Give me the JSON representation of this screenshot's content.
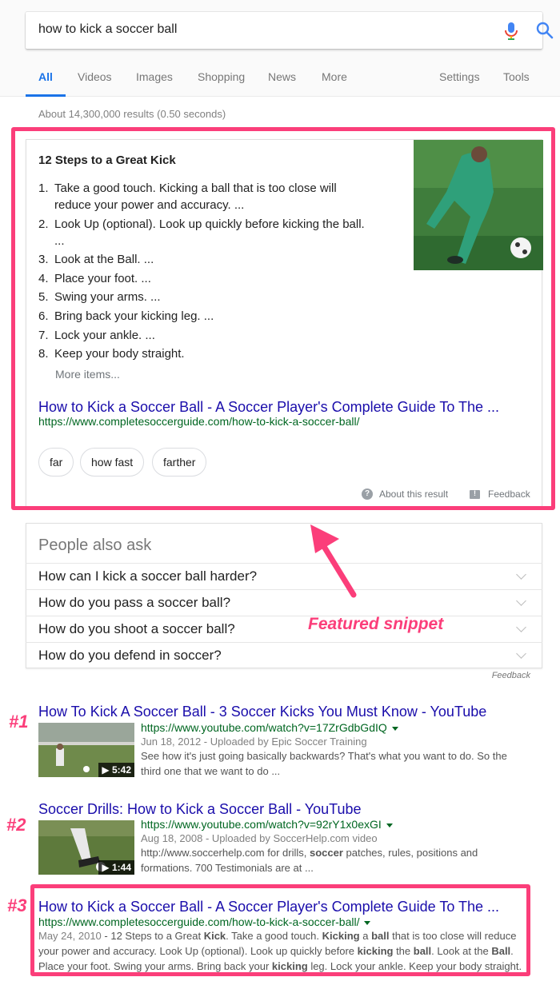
{
  "search": {
    "query": "how to kick a soccer ball"
  },
  "tabs": [
    "All",
    "Videos",
    "Images",
    "Shopping",
    "News",
    "More",
    "Settings",
    "Tools"
  ],
  "stats": "About 14,300,000 results (0.50 seconds)",
  "snippet": {
    "title": "12 Steps to a Great Kick",
    "steps": [
      {
        "num": "1.",
        "lines": [
          "Take a good touch. Kicking a ball that is too close will",
          "reduce your power and accuracy. ..."
        ]
      },
      {
        "num": "2.",
        "lines": [
          "Look Up (optional). Look up quickly before kicking the ball.",
          "..."
        ]
      },
      {
        "num": "3.",
        "lines": [
          "Look at the Ball. ..."
        ]
      },
      {
        "num": "4.",
        "lines": [
          "Place your foot. ..."
        ]
      },
      {
        "num": "5.",
        "lines": [
          "Swing your arms. ..."
        ]
      },
      {
        "num": "6.",
        "lines": [
          "Bring back your kicking leg. ..."
        ]
      },
      {
        "num": "7.",
        "lines": [
          "Lock your ankle. ..."
        ]
      },
      {
        "num": "8.",
        "lines": [
          "Keep your body straight."
        ]
      }
    ],
    "more_items": "More items...",
    "result_title": "How to Kick a Soccer Ball - A Soccer Player's Complete Guide To The ...",
    "result_url": "https://www.completesoccerguide.com/how-to-kick-a-soccer-ball/",
    "chips": [
      "far",
      "how fast",
      "farther"
    ],
    "about": "About this result",
    "feedback": "Feedback"
  },
  "annotations": {
    "featured": "Featured snippet",
    "r1": "#1",
    "r2": "#2",
    "r3": "#3"
  },
  "paa": {
    "title": "People also ask",
    "questions": [
      "How can I kick a soccer ball harder?",
      "How do you pass a soccer ball?",
      "How do you shoot a soccer ball?",
      "How do you defend in soccer?"
    ],
    "feedback": "Feedback"
  },
  "results": [
    {
      "title": "How To Kick A Soccer Ball - 3 Soccer Kicks You Must Know - YouTube",
      "url": "https://www.youtube.com/watch?v=17ZrGdbGdIQ",
      "meta": "Jun 18, 2012 - Uploaded by Epic Soccer Training",
      "desc1": "See how it's just going basically backwards? That's what you want to do. So the",
      "desc2": "third one that we want to do ...",
      "duration": "▶ 5:42"
    },
    {
      "title": "Soccer Drills: How to Kick a Soccer Ball - YouTube",
      "url": "https://www.youtube.com/watch?v=92rY1x0exGI",
      "meta": "Aug 18, 2008 - Uploaded by SoccerHelp.com video",
      "desc1a": "http://www.soccerhelp.com for drills, ",
      "desc1b": "soccer",
      "desc1c": " patches, rules, positions and",
      "desc2": "formations. 700 Testimonials are at ...",
      "duration": "▶ 1:44"
    },
    {
      "title": "How to Kick a Soccer Ball - A Soccer Player's Complete Guide To The ...",
      "url": "https://www.completesoccerguide.com/how-to-kick-a-soccer-ball/",
      "date": "May 24, 2010",
      "line1": [
        " - 12 Steps to a Great ",
        "Kick",
        ". Take a good touch. ",
        "Kicking",
        " a ",
        "ball",
        " that is too close will reduce"
      ],
      "line2": [
        "your power and accuracy. Look Up (optional). Look up quickly before ",
        "kicking",
        " the ",
        "ball",
        ". Look at the ",
        "Ball",
        "."
      ],
      "line3": [
        "Place your foot. Swing your arms. Bring back your ",
        "kicking",
        " leg. Lock your ankle. Keep your body straight."
      ]
    }
  ],
  "colors": {
    "accent": "#1a73e8",
    "link": "#1a0dab",
    "url": "#006621",
    "highlight": "#fb3e7a"
  }
}
